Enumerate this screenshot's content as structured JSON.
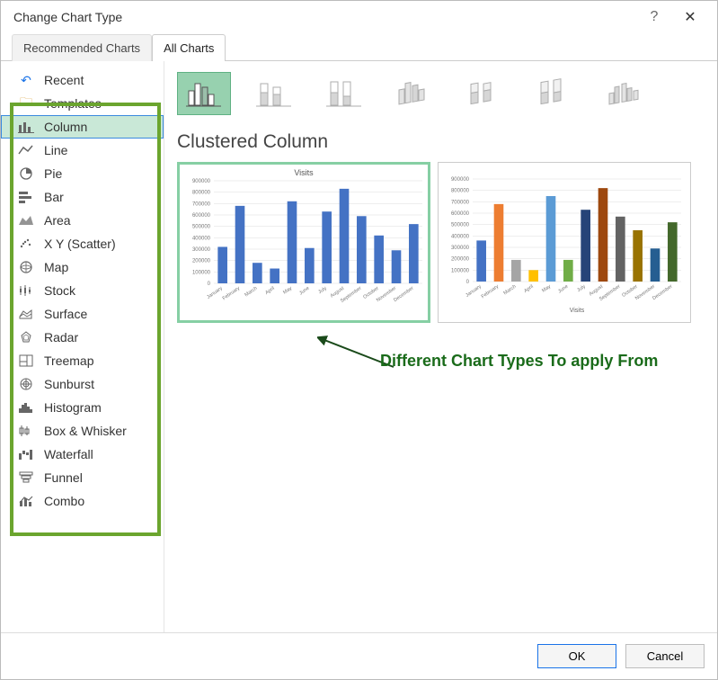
{
  "window": {
    "title": "Change Chart Type",
    "help": "?",
    "close": "✕"
  },
  "tabs": {
    "recommended": "Recommended Charts",
    "all": "All Charts"
  },
  "sidebar": {
    "items": [
      {
        "label": "Recent"
      },
      {
        "label": "Templates"
      },
      {
        "label": "Column"
      },
      {
        "label": "Line"
      },
      {
        "label": "Pie"
      },
      {
        "label": "Bar"
      },
      {
        "label": "Area"
      },
      {
        "label": "X Y (Scatter)"
      },
      {
        "label": "Map"
      },
      {
        "label": "Stock"
      },
      {
        "label": "Surface"
      },
      {
        "label": "Radar"
      },
      {
        "label": "Treemap"
      },
      {
        "label": "Sunburst"
      },
      {
        "label": "Histogram"
      },
      {
        "label": "Box & Whisker"
      },
      {
        "label": "Waterfall"
      },
      {
        "label": "Funnel"
      },
      {
        "label": "Combo"
      }
    ]
  },
  "main": {
    "subtype_title": "Clustered Column",
    "preview_title": "Visits"
  },
  "annotation": {
    "text": "Different Chart Types To apply From"
  },
  "footer": {
    "ok": "OK",
    "cancel": "Cancel"
  },
  "chart_data": [
    {
      "type": "bar",
      "title": "Visits",
      "categories": [
        "January",
        "February",
        "March",
        "April",
        "May",
        "June",
        "July",
        "August",
        "September",
        "October",
        "November",
        "December"
      ],
      "values": [
        320000,
        680000,
        180000,
        130000,
        720000,
        310000,
        630000,
        830000,
        590000,
        420000,
        290000,
        520000
      ],
      "ylim": [
        0,
        900000
      ],
      "ytick": 100000,
      "series_color": "#4472c4"
    },
    {
      "type": "bar",
      "title": "",
      "xlabel": "Visits",
      "categories": [
        "January",
        "February",
        "March",
        "April",
        "May",
        "June",
        "July",
        "August",
        "September",
        "October",
        "November",
        "December"
      ],
      "values": [
        360000,
        680000,
        190000,
        100000,
        750000,
        190000,
        630000,
        820000,
        570000,
        450000,
        290000,
        520000
      ],
      "ylim": [
        0,
        900000
      ],
      "ytick": 100000,
      "series_colors": [
        "#4472c4",
        "#ed7d31",
        "#a5a5a5",
        "#ffc000",
        "#5b9bd5",
        "#70ad47",
        "#264478",
        "#9e480e",
        "#636363",
        "#997300",
        "#255e91",
        "#43682b"
      ]
    }
  ]
}
